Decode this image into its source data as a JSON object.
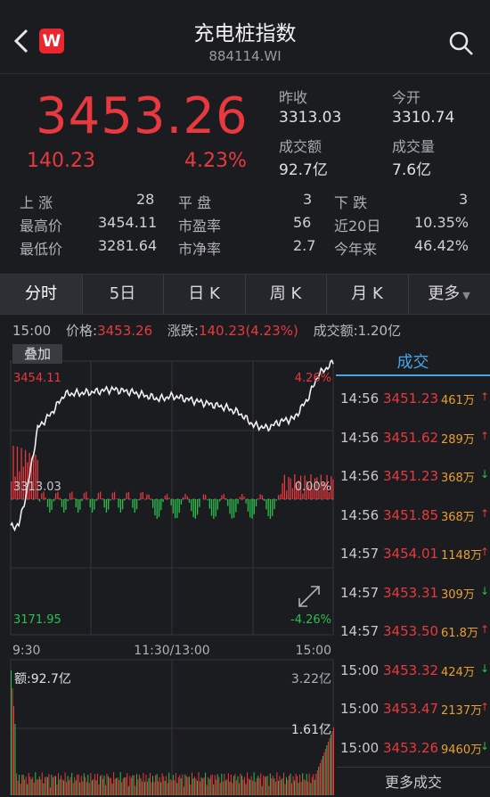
{
  "header": {
    "title": "充电桩指数",
    "code": "884114.WI",
    "logo": "W"
  },
  "quote": {
    "price": "3453.26",
    "change": "140.23",
    "pct": "4.23%",
    "prev_close_label": "昨收",
    "prev_close": "3313.03",
    "open_label": "今开",
    "open": "3310.74",
    "amount_label": "成交额",
    "amount": "92.7亿",
    "volume_label": "成交量",
    "volume": "7.6亿"
  },
  "stats": {
    "up_label": "上 涨",
    "up": "28",
    "flat_label": "平 盘",
    "flat": "3",
    "down_label": "下 跌",
    "down": "3",
    "high_label": "最高价",
    "high": "3454.11",
    "pe_label": "市盈率",
    "pe": "56",
    "d20_label": "近20日",
    "d20": "10.35%",
    "low_label": "最低价",
    "low": "3281.64",
    "pb_label": "市净率",
    "pb": "2.7",
    "ytd_label": "今年来",
    "ytd": "46.42%"
  },
  "tabs": [
    "分时",
    "5日",
    "日 K",
    "周 K",
    "月 K",
    "更多"
  ],
  "info": {
    "time": "15:00",
    "price_label": "价格:",
    "price": "3453.26",
    "chg_label": "涨跌:",
    "chg": "140.23(4.23%)",
    "amt_label": "成交额:",
    "amt": "1.20亿"
  },
  "chart": {
    "overlay_label": "叠加",
    "top_price": "3454.11",
    "mid_price": "3313.03",
    "bot_price": "3171.95",
    "top_pct": "4.26%",
    "mid_pct": "0.00%",
    "bot_pct": "-4.26%",
    "t_start": "9:30",
    "t_mid": "11:30/13:00",
    "t_end": "15:00",
    "vol_label": "额:92.7亿",
    "vol_max": "3.22亿",
    "vol_mid": "1.61亿"
  },
  "trades_header": "成交",
  "trades": [
    {
      "time": "14:56",
      "price": "3451.23",
      "vol": "461万",
      "dir": "up"
    },
    {
      "time": "14:56",
      "price": "3451.62",
      "vol": "289万",
      "dir": "up"
    },
    {
      "time": "14:56",
      "price": "3451.23",
      "vol": "368万",
      "dir": "down"
    },
    {
      "time": "14:56",
      "price": "3451.85",
      "vol": "368万",
      "dir": "up"
    },
    {
      "time": "14:57",
      "price": "3454.01",
      "vol": "1148万",
      "dir": "up"
    },
    {
      "time": "14:57",
      "price": "3453.31",
      "vol": "309万",
      "dir": "down"
    },
    {
      "time": "14:57",
      "price": "3453.50",
      "vol": "61.8万",
      "dir": "up"
    },
    {
      "time": "15:00",
      "price": "3453.32",
      "vol": "424万",
      "dir": "down"
    },
    {
      "time": "15:00",
      "price": "3453.47",
      "vol": "2137万",
      "dir": "up"
    },
    {
      "time": "15:00",
      "price": "3453.26",
      "vol": "9460万",
      "dir": "down"
    }
  ],
  "more_trades": "更多成交"
}
